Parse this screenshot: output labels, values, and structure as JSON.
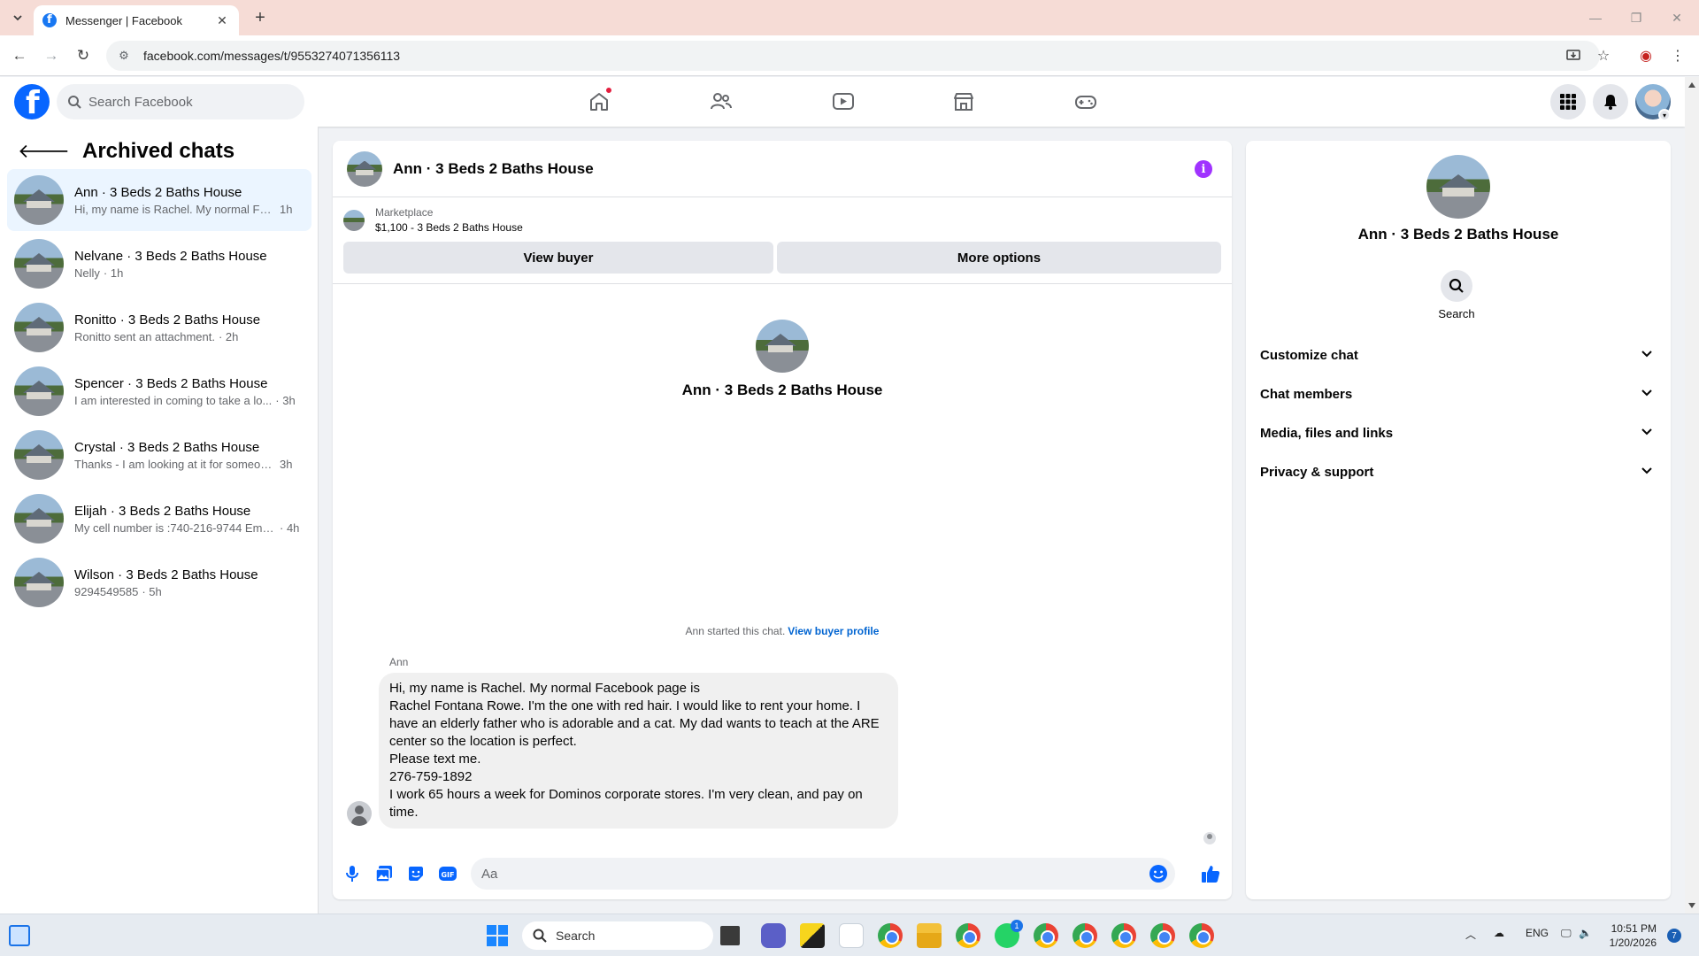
{
  "browser": {
    "tab_title": "Messenger | Facebook",
    "url": "facebook.com/messages/t/9553274071356113"
  },
  "fb_header": {
    "search_placeholder": "Search Facebook"
  },
  "sidebar": {
    "title": "Archived chats",
    "chats": [
      {
        "name": "Ann · 3 Beds 2 Baths House",
        "preview": "Hi, my name is Rachel. My normal Fac...",
        "time": "1h"
      },
      {
        "name": "Nelvane · 3 Beds 2 Baths House",
        "preview": "Nelly",
        "time": "· 1h"
      },
      {
        "name": "Ronitto · 3 Beds 2 Baths House",
        "preview": "Ronitto sent an attachment.",
        "time": "· 2h"
      },
      {
        "name": "Spencer · 3 Beds 2 Baths House",
        "preview": "I am interested in coming to take a lo...",
        "time": "· 3h"
      },
      {
        "name": "Crystal · 3 Beds 2 Baths House",
        "preview": "Thanks - I am looking at it for someon...",
        "time": "3h"
      },
      {
        "name": "Elijah · 3 Beds 2 Baths House",
        "preview": "My cell number is :740-216-9744 Ema...",
        "time": "· 4h"
      },
      {
        "name": "Wilson · 3 Beds 2 Baths House",
        "preview": "9294549585",
        "time": "· 5h"
      }
    ]
  },
  "chat": {
    "title": "Ann · 3 Beds 2 Baths House",
    "marketplace_label": "Marketplace",
    "listing": "$1,100 - 3 Beds 2 Baths House",
    "view_buyer": "View buyer",
    "more_options": "More options",
    "intro_name": "Ann · 3 Beds 2 Baths House",
    "started_text": "Ann started this chat.",
    "view_buyer_profile": "View buyer profile",
    "sender": "Ann",
    "message_lines": [
      "Hi, my name is Rachel. My normal Facebook page is",
      "Rachel Fontana Rowe. I'm the one with red hair. I would like to rent your home. I have an elderly father who is adorable and a cat. My dad wants to teach at the ARE center so the location is perfect.",
      "Please text me.",
      "276-759-1892",
      "I work 65 hours a week for Dominos corporate stores. I'm very clean, and pay on time."
    ],
    "composer_placeholder": "Aa"
  },
  "right_panel": {
    "name": "Ann · 3 Beds 2 Baths House",
    "search_label": "Search",
    "sections": [
      "Customize chat",
      "Chat members",
      "Media, files and links",
      "Privacy & support"
    ]
  },
  "taskbar": {
    "search_label": "Search",
    "language": "ENG",
    "time": "10:51 PM",
    "date": "1/20/2026",
    "notification_count": "7",
    "whatsapp_badge": "1"
  },
  "colors": {
    "fb_blue": "#0866ff",
    "messenger_purple": "#a033ff",
    "link_blue": "#0064d1",
    "active_chat_bg": "#ebf5ff",
    "tabstrip": "#f6dcd6"
  }
}
